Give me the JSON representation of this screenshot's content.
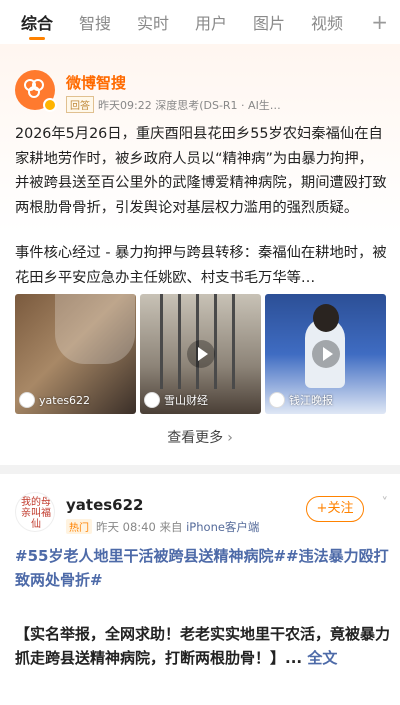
{
  "tabs": [
    "综合",
    "智搜",
    "实时",
    "用户",
    "图片",
    "视频"
  ],
  "tab_add": "+",
  "card1": {
    "account": "微博智搜",
    "tag": "回答",
    "meta": "昨天09:22 深度思考(DS-R1 · AI生…",
    "summary": "2026年5月26日，重庆酉阳县花田乡55岁农妇秦福仙在自家耕地劳作时，被乡政府人员以“精神病”为由暴力拘押，并被跨县送至百公里外的武隆博爱精神病院，期间遭殴打致两根肋骨骨折，引发舆论对基层权力滥用的强烈质疑。",
    "detail": "事件核心经过 - 暴力拘押与跨县转移：秦福仙在耕地时，被花田乡平安应急办主任姚欧、村支书毛万华等…",
    "media": [
      {
        "label": "yates622"
      },
      {
        "label": "雪山财经"
      },
      {
        "label": "钱江晚报"
      }
    ],
    "see_more": "查看更多",
    "see_more_chev": "›"
  },
  "card2": {
    "avatar_text": "我的母亲叫福仙",
    "account": "yates622",
    "tag": "热门",
    "time": "昨天 08:40",
    "from": "来自",
    "source": "iPhone客户端",
    "follow": "+关注",
    "chevron": "˅",
    "topic": "#55岁老人地里干活被跨县送精神病院##违法暴力殴打致两处骨折#",
    "body": "【实名举报，全网求助！老老实实地里干农活，竟被暴力抓走跨县送精神病院，打断两根肋骨！】...",
    "full_text": "全文"
  }
}
